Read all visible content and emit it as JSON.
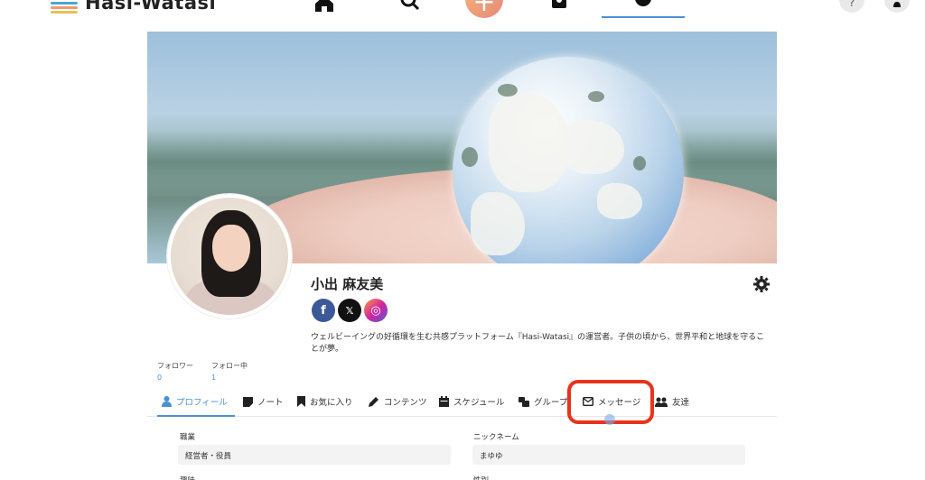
{
  "app": {
    "logo_text": "Hasi-Watasi"
  },
  "nav": {
    "plus_label": "+",
    "help_label": "?"
  },
  "profile": {
    "name": "小出 麻友美",
    "bio": "ウェルビーイングの好循環を生む共感プラットフォーム『Hasi-Watasi』の運営者。子供の頃から、世界平和と地球を守ることが夢。",
    "social": [
      {
        "name": "facebook",
        "glyph": "f",
        "color": "#3b5998"
      },
      {
        "name": "x",
        "glyph": "𝕏",
        "color": "#111111"
      },
      {
        "name": "instagram",
        "glyph": "◎",
        "color": "#c13584"
      }
    ]
  },
  "stats": {
    "followers_label": "フォロワー",
    "followers_value": "0",
    "following_label": "フォロー中",
    "following_value": "1"
  },
  "tabs": [
    {
      "label": "プロフィール",
      "icon": "user-icon",
      "active": true
    },
    {
      "label": "ノート",
      "icon": "note-icon",
      "active": false
    },
    {
      "label": "お気に入り",
      "icon": "bookmark-icon",
      "active": false
    },
    {
      "label": "コンテンツ",
      "icon": "pen-icon",
      "active": false
    },
    {
      "label": "スケジュール",
      "icon": "calendar-icon",
      "active": false
    },
    {
      "label": "グループ",
      "icon": "group-icon",
      "active": false
    },
    {
      "label": "メッセージ",
      "icon": "envelope-icon",
      "active": false
    },
    {
      "label": "友達",
      "icon": "users-icon",
      "active": false
    }
  ],
  "fields": {
    "occupation_label": "職業",
    "occupation_value": "経営者・役員",
    "nickname_label": "ニックネーム",
    "nickname_value": "まゆゆ",
    "partial_left_label": "趣味",
    "partial_right_label": "性別"
  },
  "colors": {
    "accent": "#4a90d9",
    "highlight": "#e8331c"
  }
}
